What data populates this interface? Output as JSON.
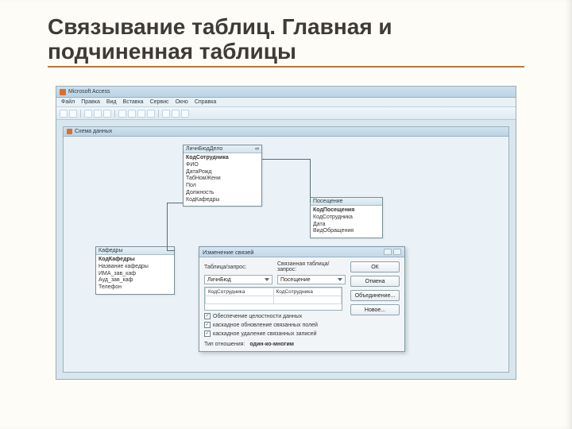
{
  "slide": {
    "title": "Связывание таблиц. Главная и подчиненная таблицы"
  },
  "app": {
    "title": "Microsoft Access",
    "menu": [
      "Файл",
      "Правка",
      "Вид",
      "Вставка",
      "Сервис",
      "Окно",
      "Справка"
    ]
  },
  "rel_window_title": "Схема данных",
  "tables": {
    "t1": {
      "name": "ЛичнБюдДело",
      "sym": "∞",
      "fields": [
        "КодСотрудника",
        "ФИО",
        "ДатаРожд",
        "ТабНомЖени",
        "Пол",
        "Должность",
        "КодКафедры"
      ]
    },
    "t2": {
      "name": "Посещение",
      "sym": "",
      "fields": [
        "КодПосещения",
        "КодСотрудника",
        "Дата",
        "ВидОбращения"
      ]
    },
    "t3": {
      "name": "Кафедры",
      "sym": "",
      "fields": [
        "КодКафедры",
        "Название кафедры",
        "ИМА_зав_каф",
        "Ауд_зав_каф",
        "Телефон"
      ]
    }
  },
  "dialog": {
    "title": "Изменение связей",
    "label_table": "Таблица/запрос:",
    "label_related": "Связанная таблица/запрос:",
    "combo1": "ЛичнБюд",
    "combo2": "Посещение",
    "grid_left": "КодСотрудника",
    "grid_right": "КодСотрудника",
    "chk1": "Обеспечение целостности данных",
    "chk2": "каскадное обновление связанных полей",
    "chk3": "каскадное удаление связанных записей",
    "type_label": "Тип отношения:",
    "type_value": "один-ко-многим",
    "buttons": {
      "ok": "ОК",
      "cancel": "Отмена",
      "join": "Объединение...",
      "new": "Новое..."
    }
  }
}
